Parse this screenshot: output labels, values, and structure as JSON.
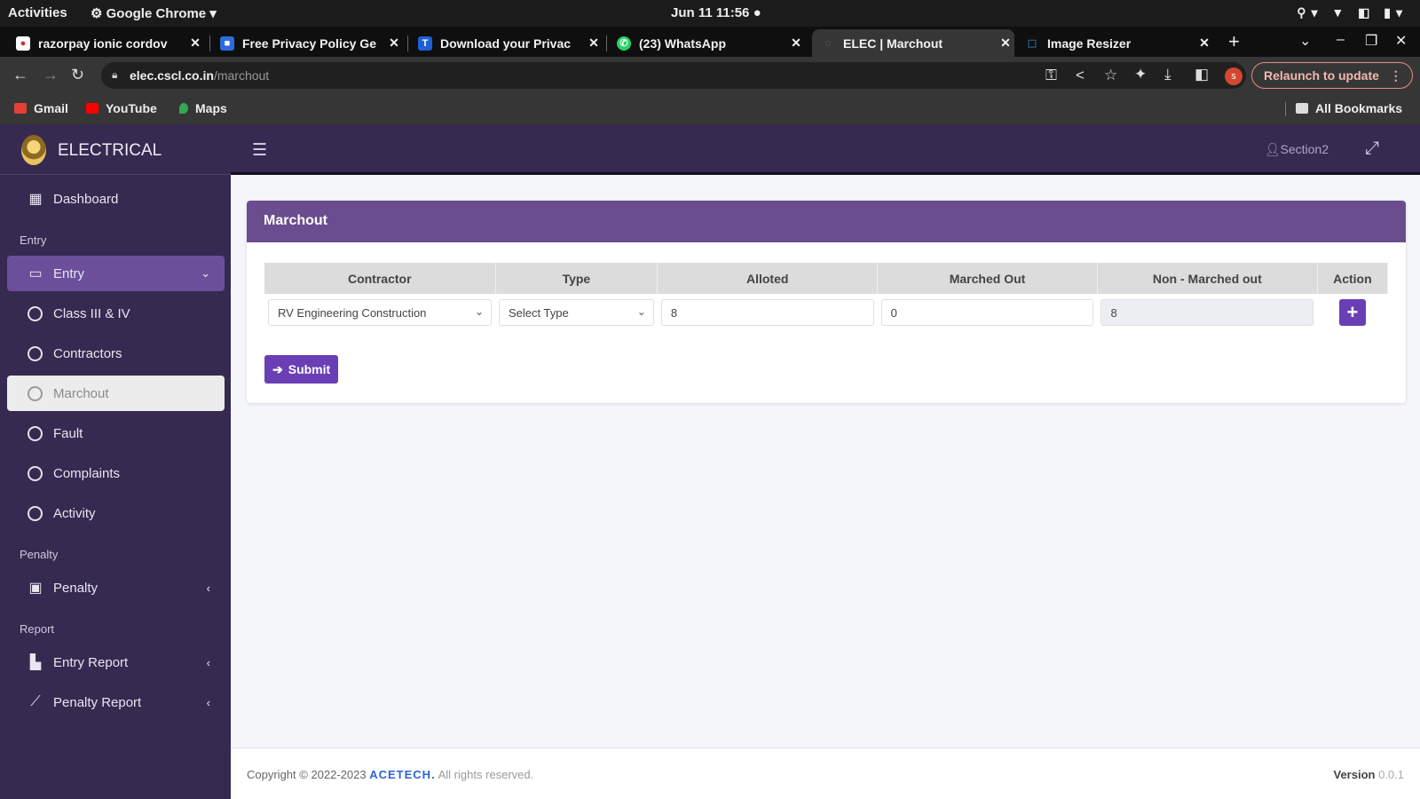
{
  "os": {
    "activities": "Activities",
    "app_menu": "⚙ Google Chrome ▾",
    "clock": "Jun 11  11:56  ●"
  },
  "tabs": [
    {
      "title": "razorpay ionic cordov",
      "fav_color": "#ffffff",
      "fav_glyph": "●"
    },
    {
      "title": "Free Privacy Policy Ge",
      "fav_color": "#2d6cdf",
      "fav_glyph": "■"
    },
    {
      "title": "Download your Privac",
      "fav_color": "#1f5fd6",
      "fav_glyph": "T"
    },
    {
      "title": "(23) WhatsApp",
      "fav_color": "#25d366",
      "fav_glyph": "✆"
    },
    {
      "title": "ELEC | Marchout",
      "fav_color": "#5a5a5a",
      "fav_glyph": "◌"
    },
    {
      "title": "Image Resizer",
      "fav_color": "#2a8de0",
      "fav_glyph": "⬚"
    }
  ],
  "address": {
    "host": "elec.cscl.co.in",
    "path": "/marchout",
    "relaunch": "Relaunch to update",
    "profile_initial": "s"
  },
  "bookmarks": [
    {
      "label": "Gmail",
      "color": "#e34133"
    },
    {
      "label": "YouTube",
      "color": "#ff0000"
    },
    {
      "label": "Maps",
      "color": "#34a853"
    }
  ],
  "all_bookmarks": "All Bookmarks",
  "sidebar": {
    "brand": "ELECTRICAL",
    "dashboard": "Dashboard",
    "groups": {
      "entry": "Entry",
      "penalty": "Penalty",
      "report": "Report"
    },
    "entry_menu": "Entry",
    "entry_items": [
      "Class III & IV",
      "Contractors",
      "Marchout",
      "Fault",
      "Complaints",
      "Activity"
    ],
    "penalty_menu": "Penalty",
    "entry_report": "Entry Report",
    "penalty_report": "Penalty Report"
  },
  "navbar": {
    "user": "Section2"
  },
  "card": {
    "title": "Marchout",
    "columns": [
      "Contractor",
      "Type",
      "Alloted",
      "Marched Out",
      "Non - Marched out",
      "Action"
    ],
    "row": {
      "contractor": "RV Engineering Construction",
      "type": "Select Type",
      "alloted": "8",
      "marched_out": "0",
      "non_marched_out": "8"
    },
    "submit": "Submit"
  },
  "footer": {
    "copyright": "Copyright © 2022-2023",
    "brand": "ACETECH.",
    "rights": "All rights reserved.",
    "version_label": "Version",
    "version": "0.0.1"
  }
}
